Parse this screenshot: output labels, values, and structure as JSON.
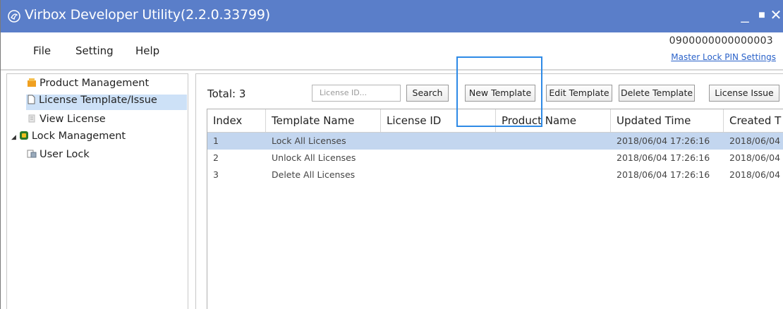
{
  "window": {
    "title": "Virbox Developer Utility(2.2.0.33799)",
    "min_label": "_",
    "max_label": "■",
    "close_label": "✕"
  },
  "menu": {
    "items": [
      "File",
      "Setting",
      "Help"
    ]
  },
  "account": {
    "serial": "0900000000000003",
    "pin_link": "Master Lock PIN Settings"
  },
  "sidebar": {
    "items": [
      {
        "label": "Product Management",
        "icon": "product-icon"
      },
      {
        "label": "License Template/Issue",
        "icon": "template-icon",
        "selected": true
      },
      {
        "label": "View License",
        "icon": "view-icon"
      },
      {
        "label": "Lock Management",
        "icon": "lock-icon",
        "expand": "◢"
      },
      {
        "label": "User Lock",
        "icon": "user-lock-icon"
      }
    ]
  },
  "toolbar": {
    "total_label": "Total: 3",
    "search_placeholder": "License ID...",
    "search_label": "Search",
    "new_template_label": "New Template",
    "edit_template_label": "Edit Template",
    "delete_template_label": "Delete Template",
    "license_issue_label": "License Issue"
  },
  "table": {
    "columns": [
      "Index",
      "Template Name",
      "License ID",
      "Product Name",
      "Updated Time",
      "Created T"
    ],
    "rows": [
      [
        "1",
        "Lock All Licenses",
        "",
        "",
        "2018/06/04 17:26:16",
        "2018/06/04"
      ],
      [
        "2",
        "Unlock All Licenses",
        "",
        "",
        "2018/06/04 17:26:16",
        "2018/06/04"
      ],
      [
        "3",
        "Delete All Licenses",
        "",
        "",
        "2018/06/04 17:26:16",
        "2018/06/04"
      ]
    ],
    "selected_row": 0
  },
  "colors": {
    "titlebar": "#5a7ec9",
    "selection": "#c3d6ef",
    "highlight": "#2e8ae6",
    "link": "#2a62c9"
  }
}
